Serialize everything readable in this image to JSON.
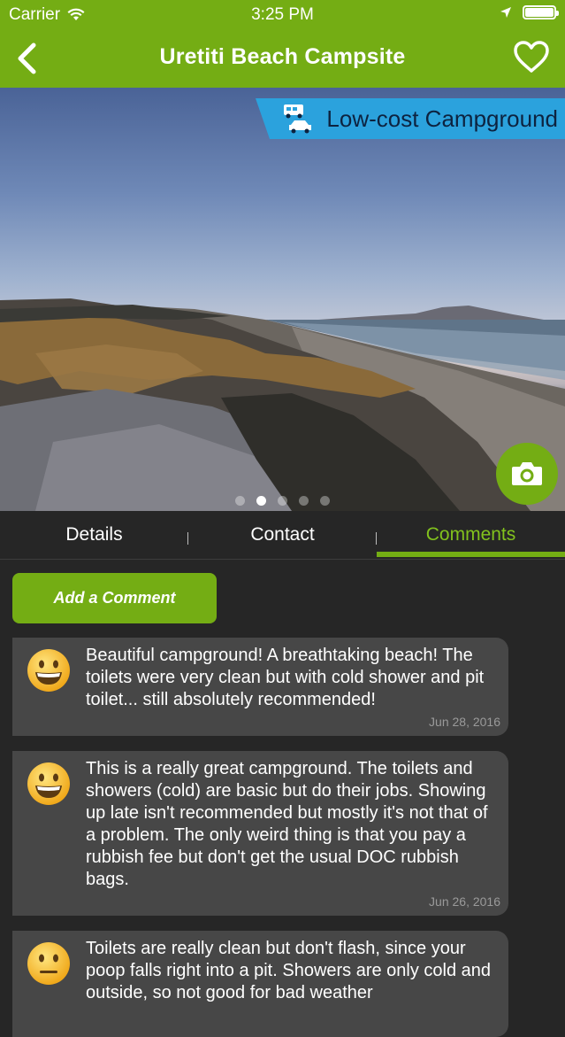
{
  "status_bar": {
    "carrier": "Carrier",
    "time": "3:25 PM"
  },
  "nav": {
    "title": "Uretiti Beach Campsite",
    "back_icon": "chevron-left-icon",
    "favorite_icon": "heart-outline-icon"
  },
  "hero": {
    "badge_label": "Low-cost Campground",
    "badge_icon": "campervan-car-icon",
    "camera_icon": "camera-icon",
    "pages": 5,
    "active_page": 2
  },
  "tabs": [
    {
      "label": "Details",
      "active": false
    },
    {
      "label": "Contact",
      "active": false
    },
    {
      "label": "Comments",
      "active": true
    }
  ],
  "add_comment_label": "Add a Comment",
  "comments": [
    {
      "sentiment": "happy",
      "text": "Beautiful campground! A breathtaking beach! The toilets were very clean but with cold shower and pit toilet... still absolutely recommended!",
      "date": "Jun 28, 2016"
    },
    {
      "sentiment": "happy",
      "text": "This is a really great campground. The toilets and showers (cold) are basic but do their jobs. Showing up late isn't recommended but mostly it's not that of a problem. The only weird thing is that you pay a rubbish fee but don't get the usual DOC rubbish bags.",
      "date": "Jun 26, 2016"
    },
    {
      "sentiment": "neutral",
      "text": "Toilets are really clean but don't flash, since your poop falls right into a pit. Showers are only cold and outside, so not good for bad weather",
      "date": ""
    }
  ],
  "colors": {
    "brand_green": "#74ad14",
    "badge_blue": "#2ba2dd",
    "background": "#262626",
    "card": "#474747"
  }
}
